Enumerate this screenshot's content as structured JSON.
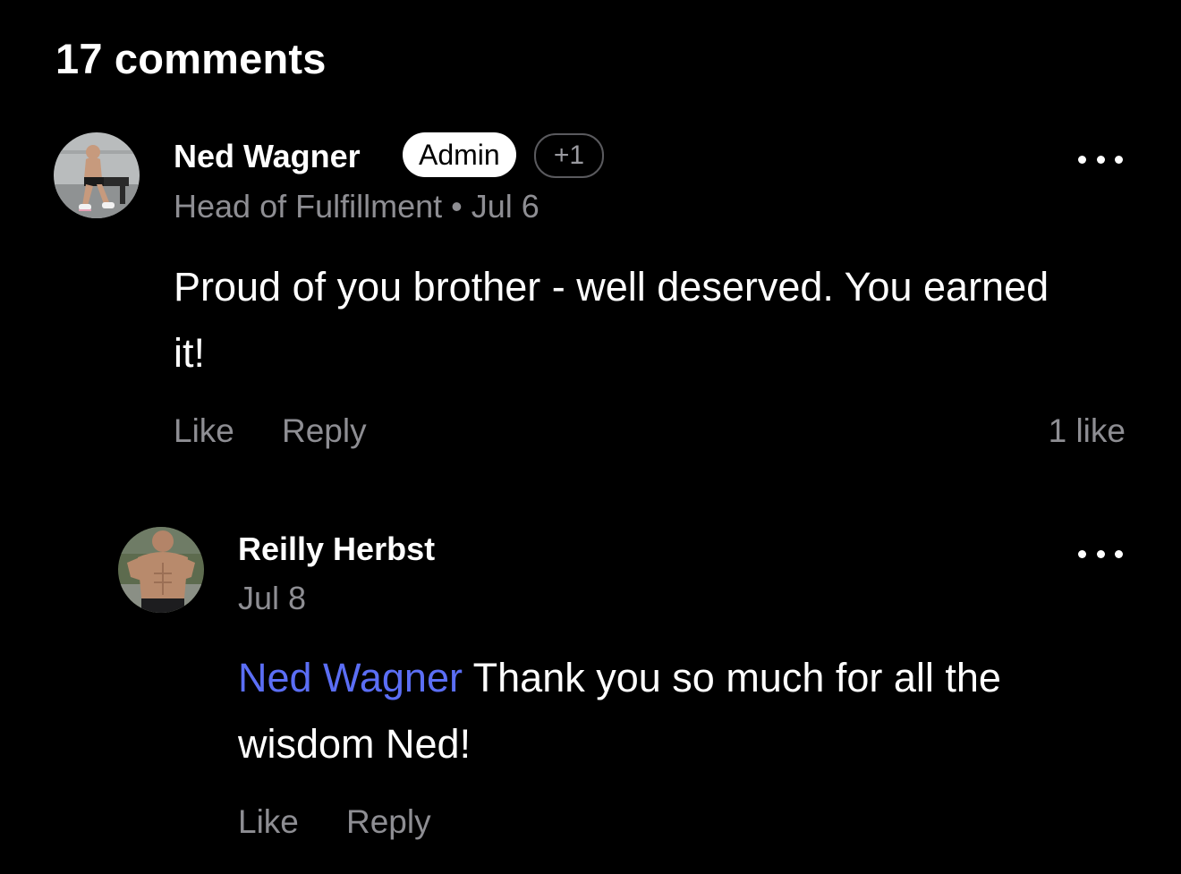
{
  "comments_heading": "17 comments",
  "comments": [
    {
      "author": "Ned Wagner",
      "badge": "Admin",
      "extra_badge": "+1",
      "role": "Head of Fulfillment",
      "separator": "•",
      "date": "Jul 6",
      "text": "Proud of you brother - well deserved. You earned it!",
      "like_label": "Like",
      "reply_label": "Reply",
      "likes_count": "1 like",
      "avatar_icon": "user-avatar-photo"
    },
    {
      "author": "Reilly Herbst",
      "date": "Jul 8",
      "mention": "Ned Wagner",
      "text": "Thank you so much for all the wisdom Ned!",
      "like_label": "Like",
      "reply_label": "Reply",
      "avatar_icon": "user-avatar-photo"
    }
  ],
  "colors": {
    "background": "#000000",
    "text": "#ffffff",
    "muted": "#8e8e93",
    "mention": "#5b6ef5"
  }
}
